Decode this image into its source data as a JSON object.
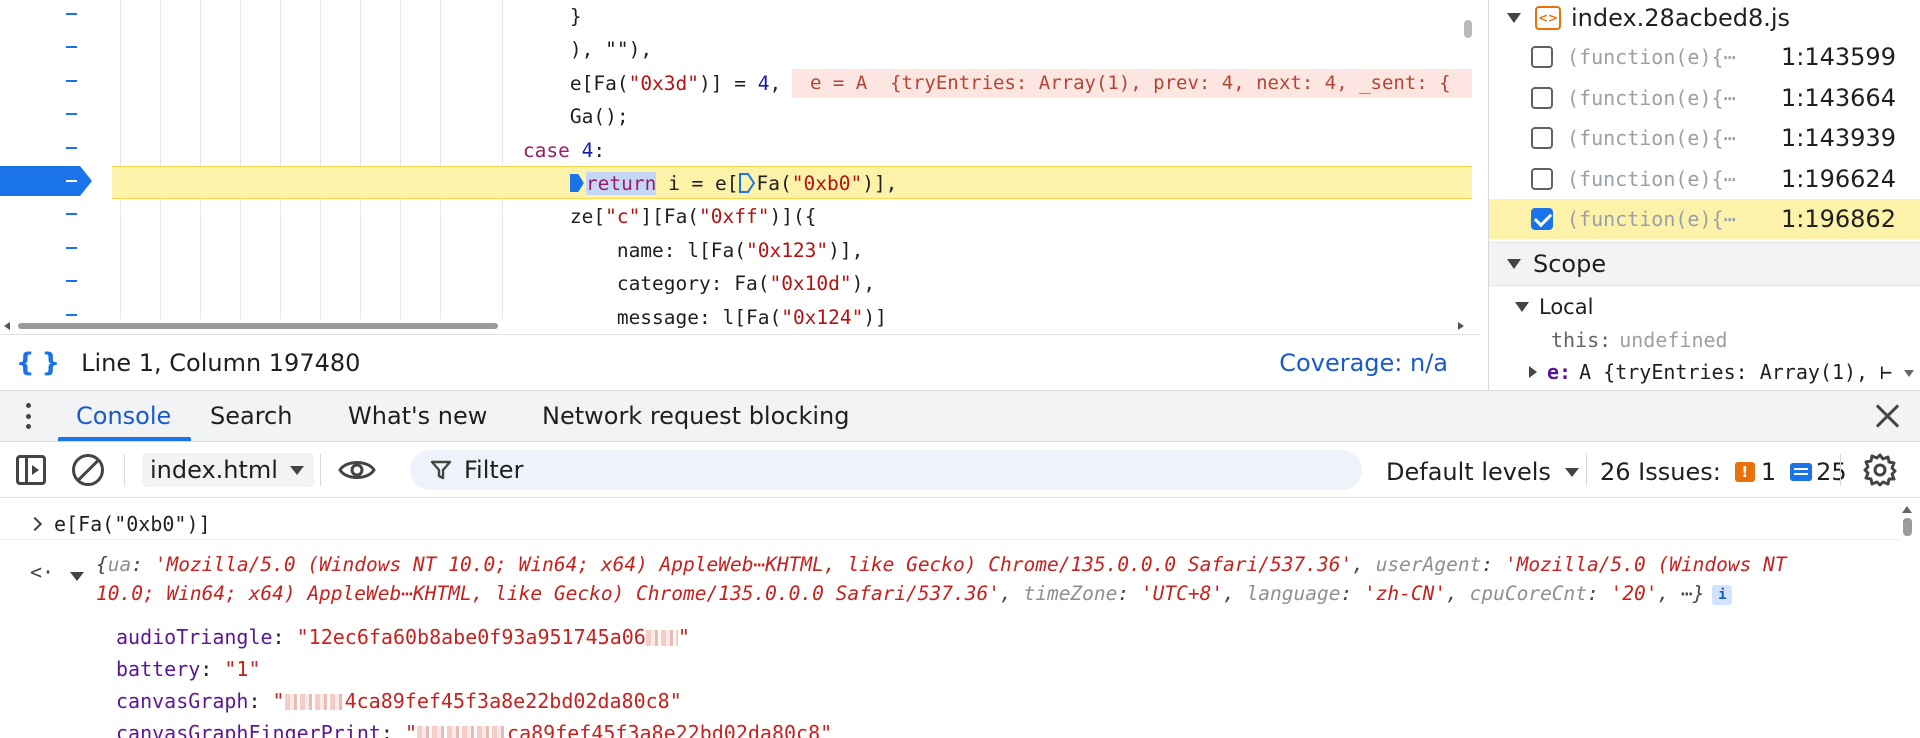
{
  "editor": {
    "lines": [
      {
        "indent": "                                       ",
        "text": "}"
      },
      {
        "indent": "                                       ",
        "text": "), \"\"),"
      },
      {
        "indent": "                                       ",
        "pre": "e[Fa(",
        "str": "\"0x3d\"",
        "post": ")] = ",
        "num": "4",
        "tail": ","
      },
      {
        "indent": "                                       ",
        "text": "Ga();"
      },
      {
        "indent": "                                   ",
        "kw": "case",
        "num": "4",
        "tail": ":"
      },
      {
        "indent": "                                       ",
        "kw": "return",
        "mid": " i = e[",
        "call": "Fa(",
        "str": "\"0xb0\"",
        "tail": ")],"
      },
      {
        "indent": "                                       ",
        "pre": "ze[",
        "str": "\"c\"",
        "mid": "][Fa(",
        "str2": "\"0xff\"",
        "tail": ")]({"
      },
      {
        "indent": "                                           ",
        "pre": "name: l[Fa(",
        "str": "\"0x123\"",
        "tail": ")],"
      },
      {
        "indent": "                                           ",
        "pre": "category: Fa(",
        "str": "\"0x10d\"",
        "tail": "),"
      },
      {
        "indent": "                                           ",
        "pre": "message: l[Fa(",
        "str": "\"0x124\"",
        "tail": ")]"
      }
    ],
    "inline_value": "e = A  {tryEntries: Array(1), prev: 4, next: 4, _sent: {"
  },
  "statusbar": {
    "braces": "{ }",
    "position": "Line 1, Column 197480",
    "coverage": "Coverage: n/a"
  },
  "sidebar": {
    "file_name": "index.28acbed8.js",
    "file_icon_glyph": "<>",
    "breakpoints": [
      {
        "fn": "(function(e){⋯",
        "loc": "1:143599",
        "checked": false
      },
      {
        "fn": "(function(e){⋯",
        "loc": "1:143664",
        "checked": false
      },
      {
        "fn": "(function(e){⋯",
        "loc": "1:143939",
        "checked": false
      },
      {
        "fn": "(function(e){⋯",
        "loc": "1:196624",
        "checked": false
      },
      {
        "fn": "(function(e){⋯",
        "loc": "1:196862",
        "checked": true
      }
    ],
    "scope_title": "Scope",
    "local_title": "Local",
    "this_key": "this:",
    "this_val": "undefined",
    "e_key": "e:",
    "e_val": "A  {tryEntries: Array(1), ⊢"
  },
  "drawer": {
    "tabs": [
      "Console",
      "Search",
      "What's new",
      "Network request blocking"
    ],
    "active_tab": 0
  },
  "toolbar": {
    "context": "index.html",
    "filter_placeholder": "Filter",
    "levels": "Default levels",
    "issues_label": "26 Issues:",
    "issues_warn_count": "1",
    "issues_info_count": "25",
    "warn_glyph": "!"
  },
  "console": {
    "prompt": "e[Fa(\"0xb0\")]",
    "return_glyph": "<·",
    "preview_parts": [
      {
        "t": "{",
        "c": "pp"
      },
      {
        "t": "ua",
        "c": "pk"
      },
      {
        "t": ": ",
        "c": "pp"
      },
      {
        "t": "'Mozilla/5.0 (Windows NT 10.0; Win64; x64) AppleWeb⋯KHTML, like Gecko) Chrome/135.0.0.0 Safari/537.36'",
        "c": "ps"
      },
      {
        "t": ", ",
        "c": "pp"
      },
      {
        "t": "userAgent",
        "c": "pk"
      },
      {
        "t": ": ",
        "c": "pp"
      },
      {
        "t": "'Mozilla/5.0 (Windows NT 10.0; Win64; x64) AppleWeb⋯KHTML, like Gecko) Chrome/135.0.0.0 Safari/537.36'",
        "c": "ps"
      },
      {
        "t": ", ",
        "c": "pp"
      },
      {
        "t": "timeZone",
        "c": "pk"
      },
      {
        "t": ": ",
        "c": "pp"
      },
      {
        "t": "'UTC+8'",
        "c": "ps"
      },
      {
        "t": ", ",
        "c": "pp"
      },
      {
        "t": "language",
        "c": "pk"
      },
      {
        "t": ": ",
        "c": "pp"
      },
      {
        "t": "'zh-CN'",
        "c": "ps"
      },
      {
        "t": ", ",
        "c": "pp"
      },
      {
        "t": "cpuCoreCnt",
        "c": "pk"
      },
      {
        "t": ": ",
        "c": "pp"
      },
      {
        "t": "'20'",
        "c": "ps"
      },
      {
        "t": ",  ⋯}",
        "c": "pp"
      }
    ],
    "info_badge": "i",
    "props": [
      {
        "k": "audioTriangle",
        "pre": "\"12ec6fa60b8abe0f93a951745a06",
        "post": "\""
      },
      {
        "k": "battery",
        "pre": "\"1\"",
        "post": ""
      },
      {
        "k": "canvasGraph",
        "pre": "\"",
        "post": "4ca89fef45f3a8e22bd02da80c8\""
      },
      {
        "k": "canvasGraphFingerPrint",
        "pre": "\"",
        "post": "ca89fef45f3a8e22bd02da80c8\""
      }
    ]
  },
  "colors": {
    "accent": "#1a73e8",
    "exec_line": "#fdf2a9",
    "inline_value_bg": "#fde5e1",
    "string": "#c5221f",
    "keyword": "#9a1b6b",
    "warning": "#e8710a"
  },
  "icons": [
    "format-braces-icon",
    "file-js-icon",
    "expand-triangle-icon",
    "sidebar-toggle-icon",
    "clear-console-icon",
    "eye-icon",
    "filter-icon",
    "dropdown-icon",
    "warning-icon",
    "info-icon",
    "gear-icon",
    "close-icon",
    "kebab-menu-icon"
  ]
}
